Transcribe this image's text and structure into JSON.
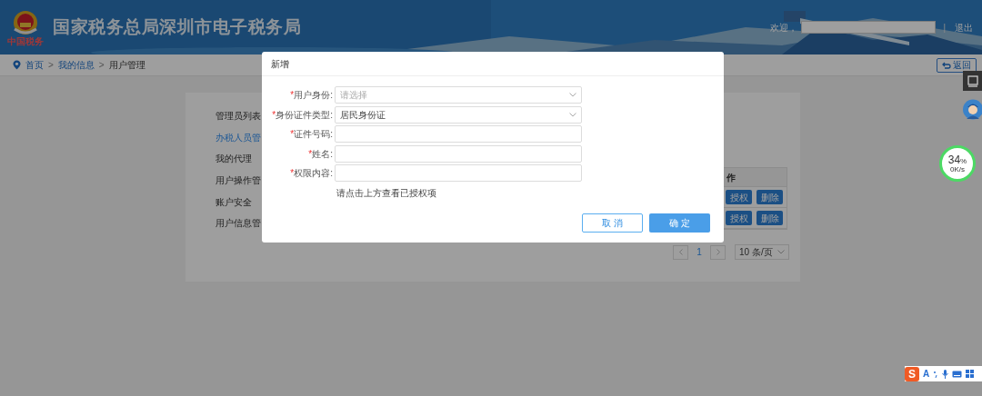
{
  "header": {
    "title": "国家税务总局深圳市电子税务局",
    "emblem_caption": "中国税务",
    "welcome_label": "欢迎，",
    "separator": "|",
    "logout": "退出"
  },
  "breadcrumb": [
    {
      "label": "首页",
      "current": false
    },
    {
      "label": "我的信息",
      "current": false
    },
    {
      "label": "用户管理",
      "current": true
    }
  ],
  "breadcrumb_separator": ">",
  "back_button": "返回",
  "menu": [
    {
      "label": "管理员列表",
      "selected": false
    },
    {
      "label": "办税人员管",
      "selected": true
    },
    {
      "label": "我的代理",
      "selected": false
    },
    {
      "label": "用户操作管",
      "selected": false
    },
    {
      "label": "账户安全",
      "selected": false
    },
    {
      "label": "用户信息管",
      "selected": false
    }
  ],
  "table": {
    "column_header": "作",
    "rows": [
      {
        "actions": [
          "授权",
          "删除"
        ]
      },
      {
        "actions": [
          "授权",
          "删除"
        ]
      }
    ]
  },
  "pagination": {
    "page": "1",
    "page_size": "10 条/页"
  },
  "dialog": {
    "title": "新增",
    "fields": [
      {
        "required_mark": "*",
        "label": "用户身份:",
        "kind": "select",
        "placeholder": "请选择"
      },
      {
        "required_mark": "*",
        "label": "身份证件类型:",
        "kind": "select",
        "value": "居民身份证"
      },
      {
        "required_mark": "*",
        "label": "证件号码:",
        "kind": "text"
      },
      {
        "required_mark": "*",
        "label": "姓名:",
        "kind": "text"
      },
      {
        "required_mark": "*",
        "label": "权限内容:",
        "kind": "text"
      }
    ],
    "hint": "请点击上方查看已授权项",
    "buttons": [
      {
        "label": "取 消",
        "kind": "secondary"
      },
      {
        "label": "确 定",
        "kind": "primary"
      }
    ]
  },
  "speed_widget": {
    "percent": "34",
    "unit": "%",
    "rate": "0K/s"
  },
  "ime_toolbar": {
    "logo": "S",
    "mode": "A"
  }
}
